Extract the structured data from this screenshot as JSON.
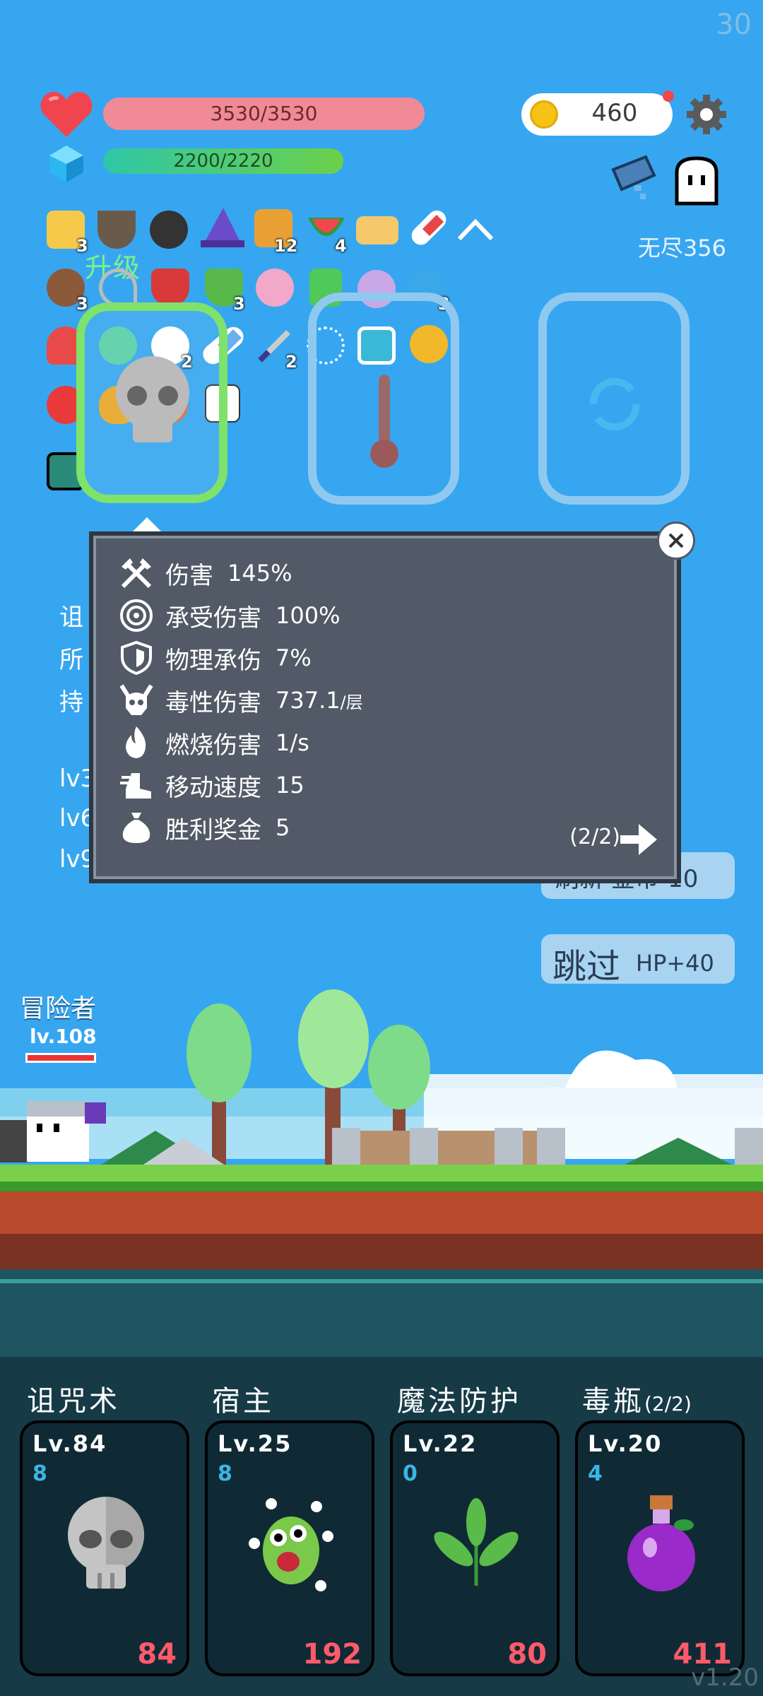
{
  "fps": "30",
  "hud": {
    "hp": "3530/3530",
    "hp_fill": 1.0,
    "mp": "2200/2220",
    "mp_fill": 0.99,
    "coins": "460",
    "mode": "无尽356"
  },
  "items": {
    "counts": [
      "3",
      "12",
      "4",
      "3",
      "3",
      "3",
      "2",
      "2"
    ],
    "upgrade_label": "升级"
  },
  "left_text": [
    "诅",
    "所",
    "持",
    "lv3",
    "lv6",
    "lv9"
  ],
  "popup": {
    "rows": [
      {
        "label": "伤害",
        "value": "145%"
      },
      {
        "label": "承受伤害",
        "value": "100%"
      },
      {
        "label": "物理承伤",
        "value": "7%"
      },
      {
        "label": "毒性伤害",
        "value": "737.1",
        "unit": "/层"
      },
      {
        "label": "燃烧伤害",
        "value": "1/s"
      },
      {
        "label": "移动速度",
        "value": "15"
      },
      {
        "label": "胜利奖金",
        "value": "5"
      }
    ],
    "page": "(2/2)"
  },
  "buttons": {
    "refresh": "刷新 金币-10",
    "skip_main": "跳过",
    "skip_sub": "HP+40"
  },
  "player": {
    "name": "冒险者",
    "level": "lv.108"
  },
  "skills": [
    {
      "name": "诅咒术",
      "extra": "",
      "level": "Lv.84",
      "sub": "8",
      "count": "84"
    },
    {
      "name": "宿主",
      "extra": "",
      "level": "Lv.25",
      "sub": "8",
      "count": "192"
    },
    {
      "name": "魔法防护",
      "extra": "",
      "level": "Lv.22",
      "sub": "0",
      "count": "80"
    },
    {
      "name": "毒瓶",
      "extra": "(2/2)",
      "level": "Lv.20",
      "sub": "4",
      "count": "411"
    }
  ],
  "version": "v1.20"
}
